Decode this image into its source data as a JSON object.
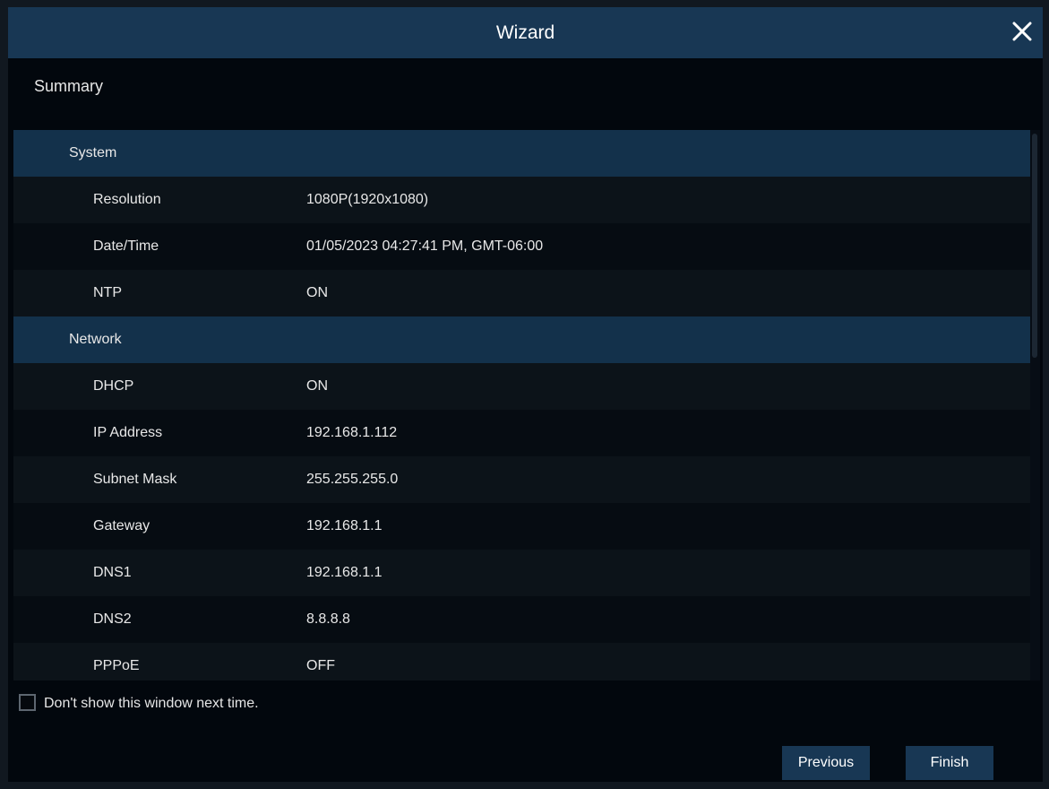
{
  "window": {
    "title": "Wizard",
    "close_icon": "close-icon"
  },
  "summary": {
    "label": "Summary"
  },
  "sections": [
    {
      "title": "System",
      "rows": [
        {
          "key": "Resolution",
          "value": "1080P(1920x1080)"
        },
        {
          "key": "Date/Time",
          "value": "01/05/2023 04:27:41 PM, GMT-06:00"
        },
        {
          "key": "NTP",
          "value": "ON"
        }
      ]
    },
    {
      "title": "Network",
      "rows": [
        {
          "key": "DHCP",
          "value": "ON"
        },
        {
          "key": "IP Address",
          "value": "192.168.1.112"
        },
        {
          "key": "Subnet Mask",
          "value": "255.255.255.0"
        },
        {
          "key": "Gateway",
          "value": "192.168.1.1"
        },
        {
          "key": "DNS1",
          "value": "192.168.1.1"
        },
        {
          "key": "DNS2",
          "value": "8.8.8.8"
        },
        {
          "key": "PPPoE",
          "value": "OFF"
        }
      ]
    }
  ],
  "dont_show": {
    "label": "Don't show this window next time.",
    "checked": false
  },
  "buttons": {
    "previous_label": "Previous",
    "finish_label": "Finish"
  },
  "colors": {
    "title_bar": "#183754",
    "section_row": "#13314b",
    "background": "#02070d",
    "button": "#183754"
  }
}
